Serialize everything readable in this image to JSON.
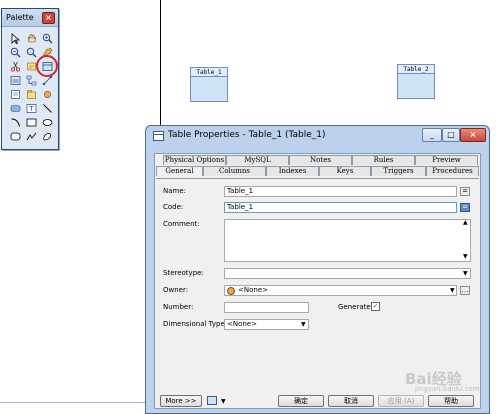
{
  "palette": {
    "title": "Palette",
    "icons": [
      "pointer-icon",
      "grab-icon",
      "zoom-in-icon",
      "zoom-out-icon",
      "zoom-window-icon",
      "open-package-icon",
      "cut-icon",
      "properties-icon",
      "table-tool-icon",
      "view-icon",
      "reference-icon",
      "link-icon",
      "procedure-icon",
      "package-icon",
      "file-icon",
      "text-icon",
      "rectangle-icon",
      "line-icon",
      "arc-icon",
      "polyline-icon",
      "ellipse-icon",
      "rounded-rect-icon",
      "freeform-icon",
      "polygon-icon"
    ]
  },
  "canvas": {
    "tables": [
      {
        "name": "Table_1"
      },
      {
        "name": "Table_2"
      }
    ]
  },
  "dialog": {
    "title": "Table Properties - Table_1 (Table_1)",
    "tabs_row1": [
      "Physical Options",
      "MySQL",
      "Notes",
      "Rules",
      "Preview"
    ],
    "tabs_row2": [
      "General",
      "Columns",
      "Indexes",
      "Keys",
      "Triggers",
      "Procedures"
    ],
    "active_tab": "General",
    "fields": {
      "name_label": "Name:",
      "name_value": "Table_1",
      "code_label": "Code:",
      "code_value": "Table_1",
      "comment_label": "Comment:",
      "comment_value": "",
      "stereotype_label": "Stereotype:",
      "stereotype_value": "",
      "owner_label": "Owner:",
      "owner_value": "<None>",
      "number_label": "Number:",
      "number_value": "",
      "generate_label": "Generate:",
      "generate_checked": true,
      "dimensional_label": "Dimensional Type:",
      "dimensional_value": "<None>"
    },
    "buttons": {
      "more": "More >>",
      "ok": "确定",
      "cancel": "取消",
      "apply": "应用 (A)",
      "help": "帮助"
    }
  },
  "watermark": {
    "text": "Bai经验",
    "sub": "jingyan.baidu.com"
  },
  "colors": {
    "highlight_circle": "#dd2222",
    "title_bar": "#bcd2ec",
    "table_fill": "#cfe3f7"
  }
}
